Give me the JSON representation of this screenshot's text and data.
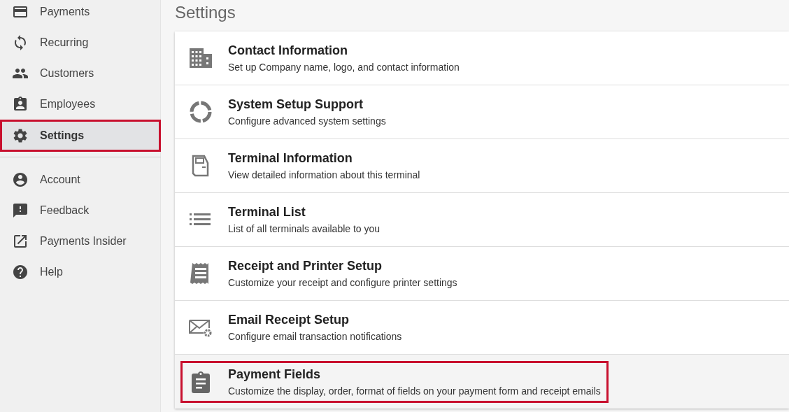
{
  "sidebar": {
    "items": [
      {
        "label": "Payments",
        "selected": false,
        "highlighted": false
      },
      {
        "label": "Recurring",
        "selected": false,
        "highlighted": false
      },
      {
        "label": "Customers",
        "selected": false,
        "highlighted": false
      },
      {
        "label": "Employees",
        "selected": false,
        "highlighted": false
      },
      {
        "label": "Settings",
        "selected": true,
        "highlighted": true
      }
    ],
    "secondary_items": [
      {
        "label": "Account",
        "selected": false,
        "highlighted": false
      },
      {
        "label": "Feedback",
        "selected": false,
        "highlighted": false
      },
      {
        "label": "Payments Insider",
        "selected": false,
        "highlighted": false
      },
      {
        "label": "Help",
        "selected": false,
        "highlighted": false
      }
    ]
  },
  "page": {
    "title": "Settings"
  },
  "settings": [
    {
      "title": "Contact Information",
      "description": "Set up Company name, logo, and contact information",
      "highlighted": false
    },
    {
      "title": "System Setup Support",
      "description": "Configure advanced system settings",
      "highlighted": false
    },
    {
      "title": "Terminal Information",
      "description": "View detailed information about this terminal",
      "highlighted": false
    },
    {
      "title": "Terminal List",
      "description": "List of all terminals available to you",
      "highlighted": false
    },
    {
      "title": "Receipt and Printer Setup",
      "description": "Customize your receipt and configure printer settings",
      "highlighted": false
    },
    {
      "title": "Email Receipt Setup",
      "description": "Configure email transaction notifications",
      "highlighted": false
    },
    {
      "title": "Payment Fields",
      "description": "Customize the display, order, format of fields on your payment form and receipt emails",
      "highlighted": true
    }
  ]
}
